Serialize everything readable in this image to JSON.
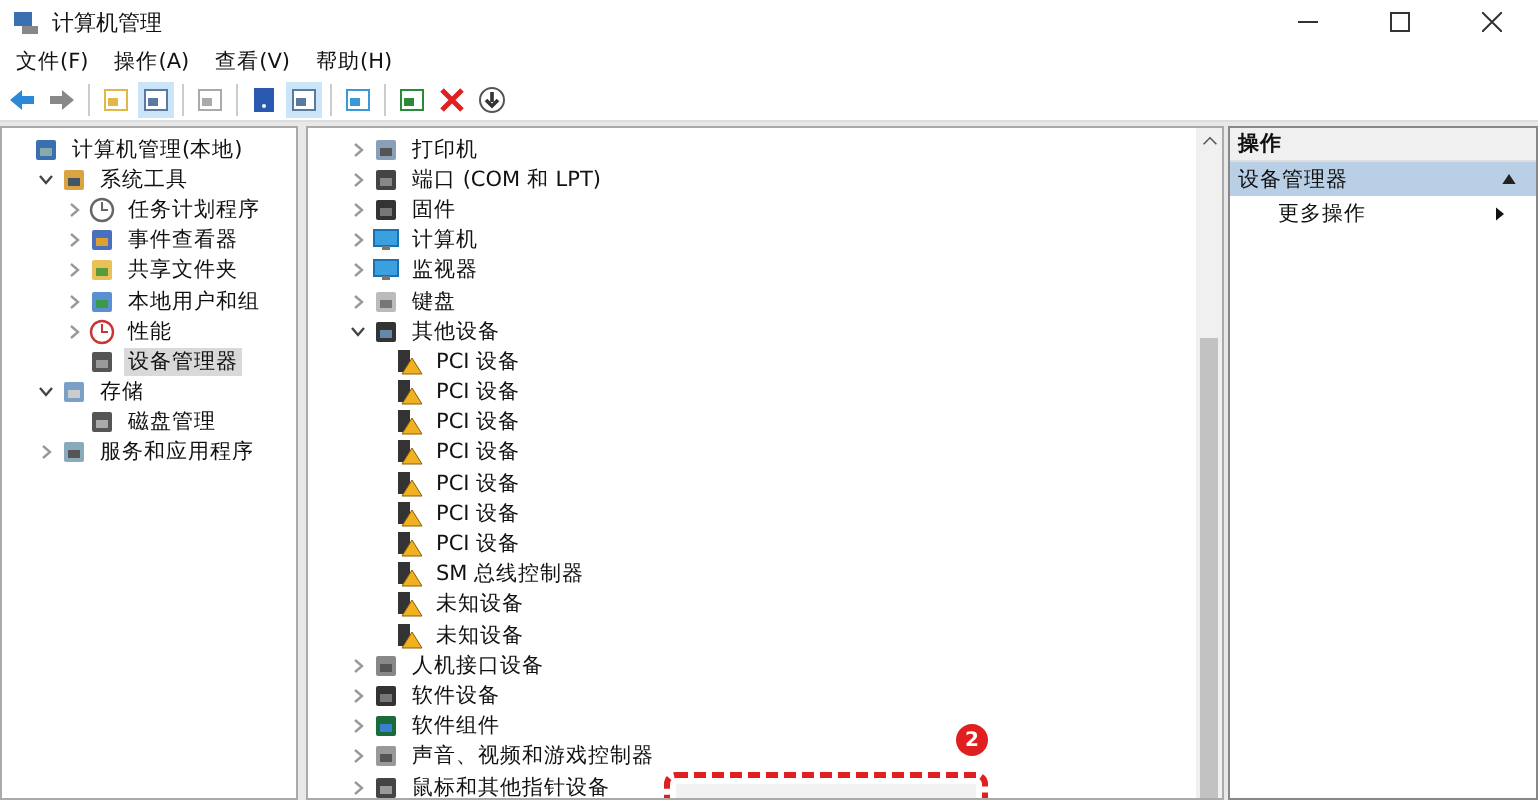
{
  "window": {
    "title": "计算机管理"
  },
  "menu": [
    "文件(F)",
    "操作(A)",
    "查看(V)",
    "帮助(H)"
  ],
  "toolbar": [
    {
      "kind": "back",
      "pressed": false
    },
    {
      "kind": "forward",
      "pressed": false
    },
    {
      "kind": "sep"
    },
    {
      "kind": "folder",
      "pressed": false
    },
    {
      "kind": "panel",
      "pressed": true
    },
    {
      "kind": "sep"
    },
    {
      "kind": "sheet",
      "pressed": false
    },
    {
      "kind": "sep"
    },
    {
      "kind": "help",
      "pressed": false
    },
    {
      "kind": "panel",
      "pressed": true
    },
    {
      "kind": "sep"
    },
    {
      "kind": "monitor",
      "pressed": false
    },
    {
      "kind": "sep"
    },
    {
      "kind": "update",
      "pressed": false
    },
    {
      "kind": "delete",
      "pressed": false
    },
    {
      "kind": "download",
      "pressed": false
    }
  ],
  "nav_tree": [
    {
      "label": "计算机管理(本地)",
      "kind": "computer",
      "selected": false,
      "children": [
        {
          "label": "系统工具",
          "kind": "tools",
          "expanded": true,
          "selected": false,
          "children": [
            {
              "label": "任务计划程序",
              "kind": "clock",
              "expanded": false,
              "selected": false
            },
            {
              "label": "事件查看器",
              "kind": "event",
              "expanded": false,
              "selected": false
            },
            {
              "label": "共享文件夹",
              "kind": "folder",
              "expanded": false,
              "selected": false
            },
            {
              "label": "本地用户和组",
              "kind": "users",
              "expanded": false,
              "selected": false
            },
            {
              "label": "性能",
              "kind": "perf",
              "expanded": false,
              "selected": false
            },
            {
              "label": "设备管理器",
              "kind": "device",
              "selected": true
            }
          ]
        },
        {
          "label": "存储",
          "kind": "storage",
          "expanded": true,
          "selected": false,
          "children": [
            {
              "label": "磁盘管理",
              "kind": "disk",
              "selected": false
            }
          ]
        },
        {
          "label": "服务和应用程序",
          "kind": "services",
          "expanded": false,
          "selected": false
        }
      ]
    }
  ],
  "device_tree": [
    {
      "label": "打印机",
      "kind": "printer",
      "expanded": false
    },
    {
      "label": "端口 (COM 和 LPT)",
      "kind": "port",
      "expanded": false
    },
    {
      "label": "固件",
      "kind": "firmware",
      "expanded": false
    },
    {
      "label": "计算机",
      "kind": "monitor",
      "expanded": false
    },
    {
      "label": "监视器",
      "kind": "monitor",
      "expanded": false
    },
    {
      "label": "键盘",
      "kind": "keyboard",
      "expanded": false
    },
    {
      "label": "其他设备",
      "kind": "other",
      "expanded": true,
      "children": [
        {
          "label": "PCI 设备",
          "kind": "warning"
        },
        {
          "label": "PCI 设备",
          "kind": "warning"
        },
        {
          "label": "PCI 设备",
          "kind": "warning"
        },
        {
          "label": "PCI 设备",
          "kind": "warning"
        },
        {
          "label": "PCI 设备",
          "kind": "warning"
        },
        {
          "label": "PCI 设备",
          "kind": "warning"
        },
        {
          "label": "PCI 设备",
          "kind": "warning"
        },
        {
          "label": "SM 总线控制器",
          "kind": "warning"
        },
        {
          "label": "未知设备",
          "kind": "warning"
        },
        {
          "label": "未知设备",
          "kind": "warning"
        }
      ]
    },
    {
      "label": "人机接口设备",
      "kind": "hid",
      "expanded": false
    },
    {
      "label": "软件设备",
      "kind": "firmware",
      "expanded": false
    },
    {
      "label": "软件组件",
      "kind": "component",
      "expanded": false
    },
    {
      "label": "声音、视频和游戏控制器",
      "kind": "sound",
      "expanded": false
    },
    {
      "label": "鼠标和其他指针设备",
      "kind": "mouse",
      "expanded": false
    }
  ],
  "callout": {
    "badge": "2"
  },
  "actions": {
    "header": "操作",
    "groups": [
      {
        "title": "设备管理器",
        "expanded": true,
        "items": [
          {
            "label": "更多操作",
            "submenu": true
          }
        ]
      }
    ]
  }
}
